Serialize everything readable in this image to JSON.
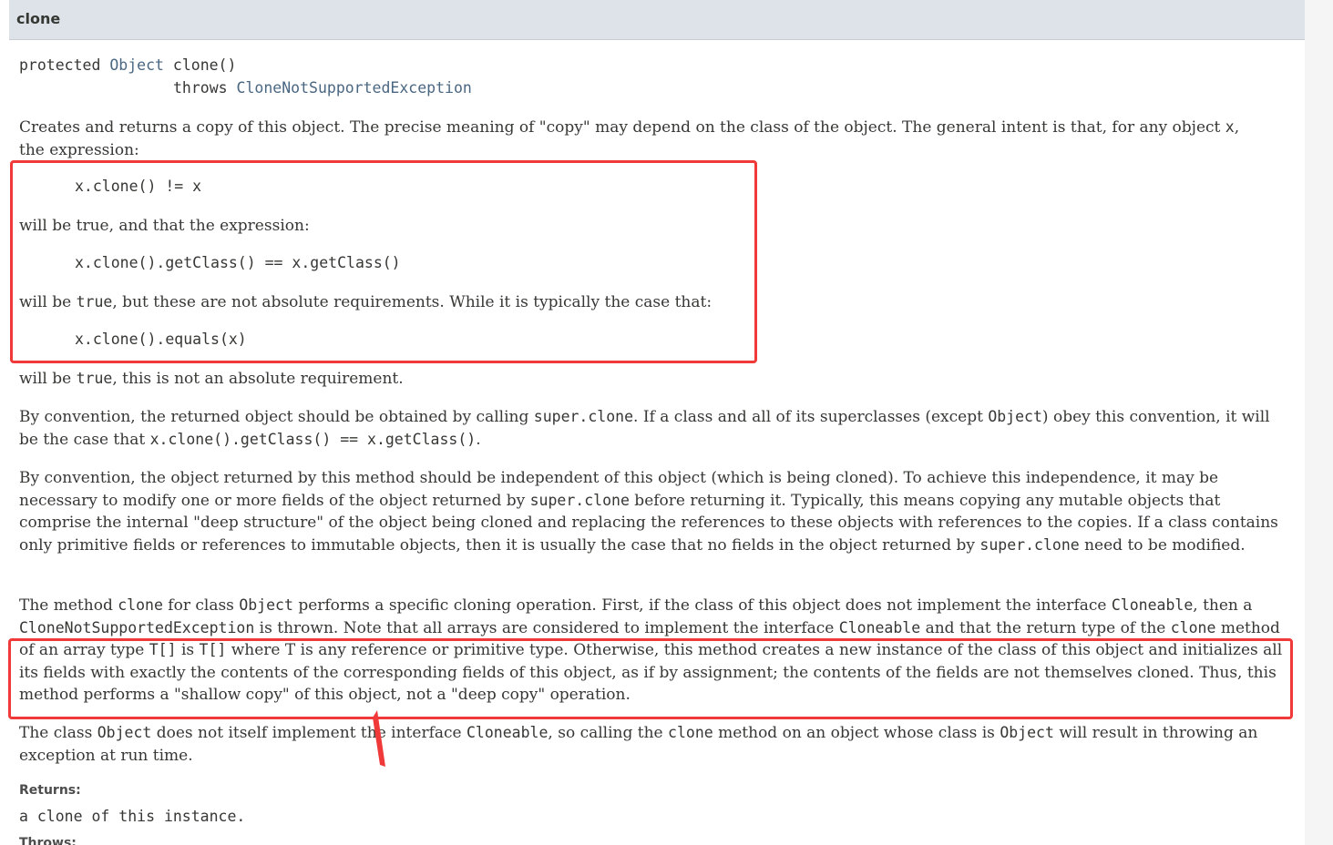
{
  "header": {
    "title": "clone"
  },
  "signature": {
    "modifier": "protected",
    "return_type": "Object",
    "method": "clone()",
    "throws_kw": "throws",
    "exception": "CloneNotSupportedException"
  },
  "para1": {
    "text": "Creates and returns a copy of this object. The precise meaning of \"copy\" may depend on the class of the object. The general intent is that, for any object ",
    "code": "x",
    "end": ","
  },
  "para1_line2": "the expression:",
  "code1": "x.clone() != x",
  "para2": "will be true, and that the expression:",
  "code2": "x.clone().getClass() == x.getClass()",
  "para3": {
    "pre": "will be ",
    "code": "true",
    "post": ", but these are not absolute requirements. While it is typically the case that:"
  },
  "code3": "x.clone().equals(x)",
  "para4": {
    "pre": "will be ",
    "code": "true",
    "post": ", this is not an absolute requirement."
  },
  "para5": {
    "t1": "By convention, the returned object should be obtained by calling ",
    "c1": "super.clone",
    "t2": ". If a class and all of its superclasses (except ",
    "c2": "Object",
    "t3": ") obey this convention, it will be the case that ",
    "c3": "x.clone().getClass() == x.getClass()",
    "t4": "."
  },
  "para6": {
    "t1": "By convention, the object returned by this method should be independent of this object (which is being cloned). To achieve this independence, it may be necessary to modify one or more fields of the object returned by ",
    "c1": "super.clone",
    "t2": " before returning it. Typically, this means copying any mutable objects that comprise the internal \"deep structure\" of the object being cloned and replacing the references to these objects with references to the copies. If a class contains only primitive fields or references to immutable objects, then it is usually the case that no fields in the object returned by ",
    "c2": "super.clone",
    "t3": " need to be modified."
  },
  "para7": {
    "t1": "The method ",
    "c1": "clone",
    "t2": " for class ",
    "c2": "Object",
    "t3": " performs a specific cloning operation. First, if the class of this object does not implement the interface ",
    "c3": "Cloneable",
    "t4": ", then a ",
    "c4": "CloneNotSupportedException",
    "t5": " is thrown. Note that all arrays are considered to implement the interface ",
    "c5": "Cloneable",
    "t6": " and that the return type of the ",
    "c6": "clone",
    "t7": " method of an array type ",
    "c7": "T[]",
    "t8": " is ",
    "c8": "T[]",
    "t9": " where T is any reference or primitive type. Otherwise, this method creates a new instance of the class of this object and initializes all its fields with exactly the contents of the corresponding fields of this object, as if by assignment; the contents of the fields are not themselves cloned. Thus, this method performs a \"shallow copy\" of this object, not a \"deep copy\" operation."
  },
  "para8": {
    "t1": "The class ",
    "c1": "Object",
    "t2": " does not itself implement the interface ",
    "c2": "Cloneable",
    "t3": ", so calling the ",
    "c3": "clone",
    "t4": " method on an object whose class is ",
    "c4": "Object",
    "t5": " will result in throwing an exception at run time."
  },
  "returns": {
    "label": "Returns:",
    "value": "a clone of this instance."
  },
  "throws": {
    "label": "Throws:"
  },
  "annotation": {
    "color": "#f03a3a"
  }
}
